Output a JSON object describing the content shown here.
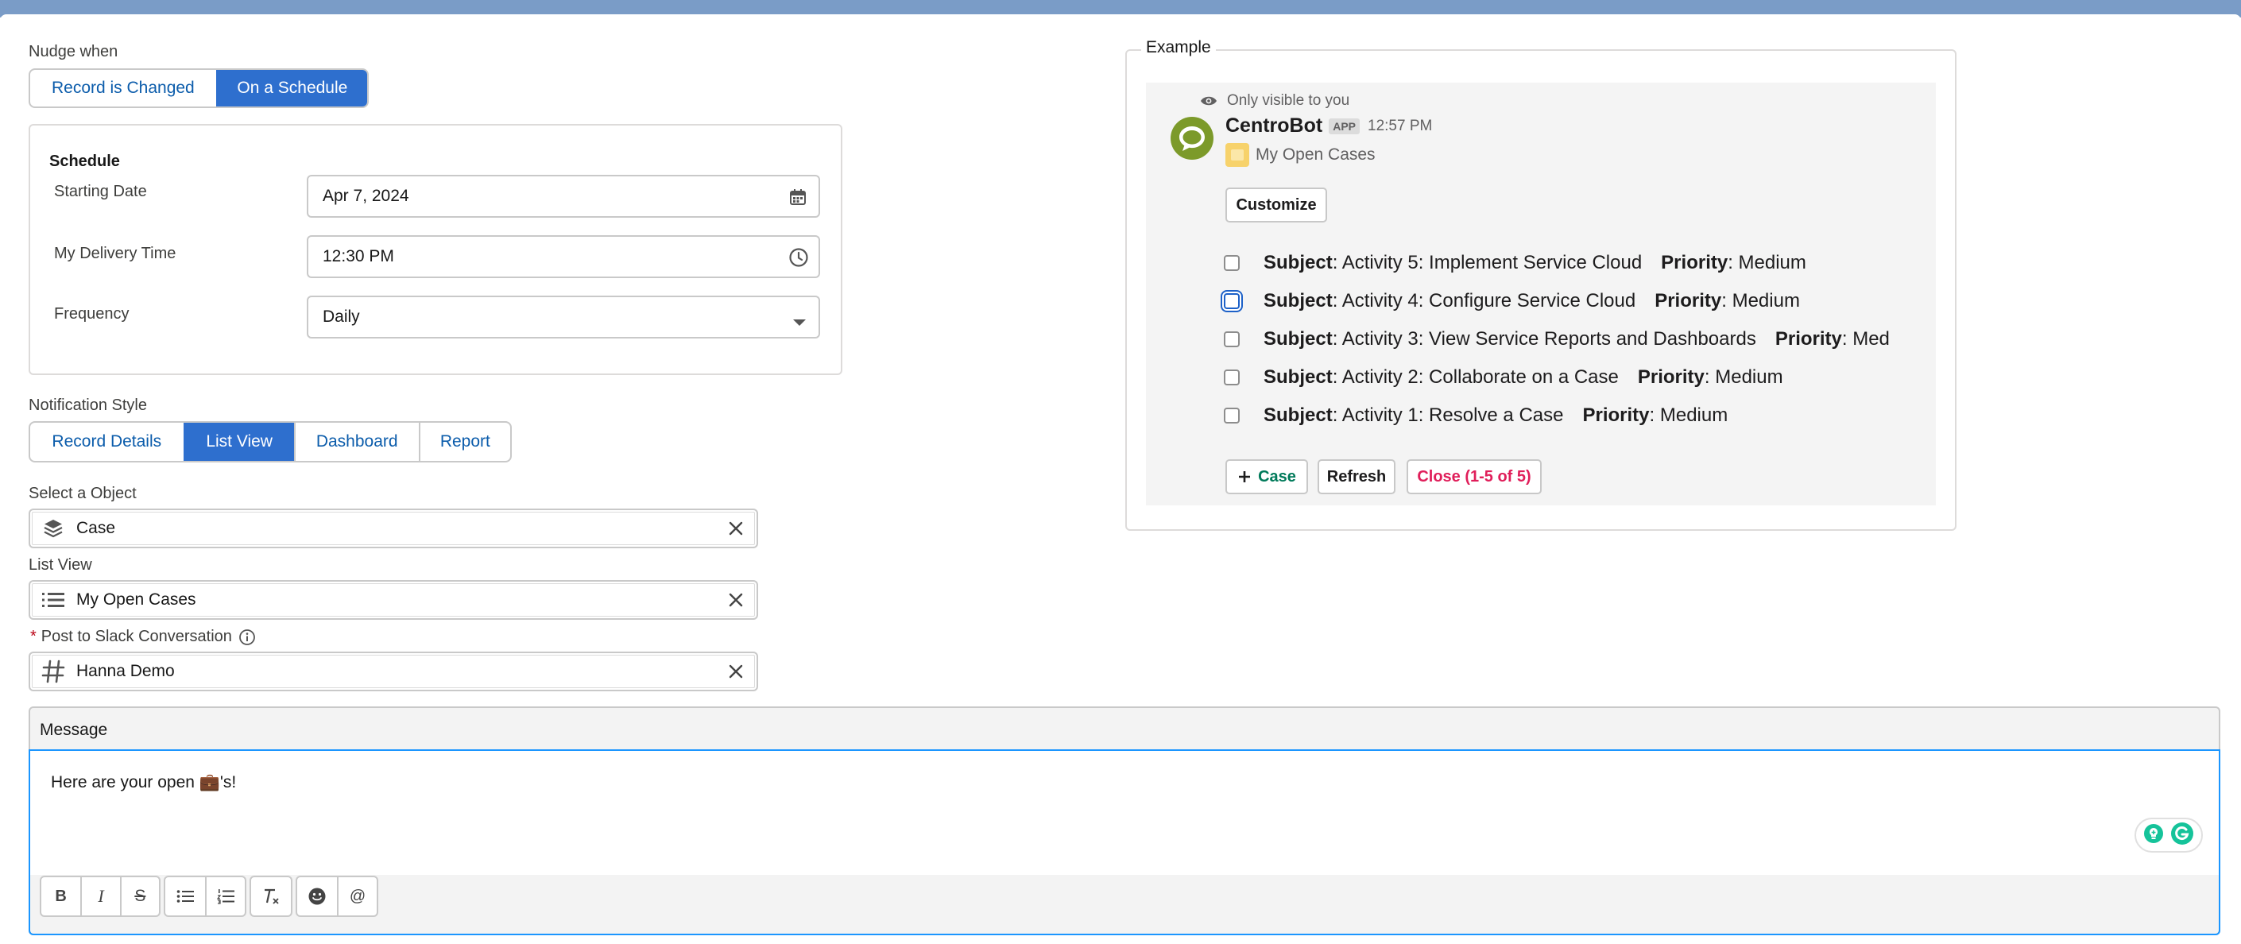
{
  "nudge": {
    "label": "Nudge when",
    "options": [
      "Record is Changed",
      "On a Schedule"
    ],
    "selected": "On a Schedule"
  },
  "schedule": {
    "title": "Schedule",
    "starting_date_label": "Starting Date",
    "starting_date_value": "Apr 7, 2024",
    "delivery_time_label": "My Delivery Time",
    "delivery_time_value": "12:30 PM",
    "frequency_label": "Frequency",
    "frequency_value": "Daily"
  },
  "notification": {
    "label": "Notification Style",
    "options": [
      "Record Details",
      "List View",
      "Dashboard",
      "Report"
    ],
    "selected": "List View"
  },
  "object_field": {
    "label": "Select a Object",
    "value": "Case",
    "icon": "stack-icon"
  },
  "list_view_field": {
    "label": "List View",
    "value": "My Open Cases",
    "icon": "list-icon"
  },
  "slack_field": {
    "required_mark": "*",
    "label": "Post to Slack Conversation",
    "value": "Hanna Demo",
    "icon": "hash-icon"
  },
  "message": {
    "header": "Message",
    "text": "Here are your open 💼's!",
    "toolbar": [
      "bold",
      "italic",
      "strikethrough",
      "bullet-list",
      "numbered-list",
      "clear-format",
      "emoji",
      "mention"
    ]
  },
  "example": {
    "legend": "Example",
    "visibility": "Only visible to you",
    "bot_name": "CentroBot",
    "app_badge": "APP",
    "time": "12:57 PM",
    "list_title": "My Open Cases",
    "customize_label": "Customize",
    "rows": [
      {
        "subject_label": "Subject",
        "subject": ": Activity 5: Implement Service Cloud",
        "priority_label": "Priority",
        "priority": ": Medium"
      },
      {
        "subject_label": "Subject",
        "subject": ": Activity 4: Configure Service Cloud",
        "priority_label": "Priority",
        "priority": ": Medium"
      },
      {
        "subject_label": "Subject",
        "subject": ": Activity 3: View Service Reports and Dashboards",
        "priority_label": "Priority",
        "priority": ": Med"
      },
      {
        "subject_label": "Subject",
        "subject": ": Activity 2: Collaborate on a Case",
        "priority_label": "Priority",
        "priority": ": Medium"
      },
      {
        "subject_label": "Subject",
        "subject": ": Activity 1: Resolve a Case",
        "priority_label": "Priority",
        "priority": ": Medium"
      }
    ],
    "add_case_label": "Case",
    "refresh_label": "Refresh",
    "close_label": "Close (1-5 of 5)"
  },
  "colors": {
    "brand": "#2e6fce",
    "link": "#0b5cab",
    "close": "#e01e5a",
    "add": "#007a5a",
    "bot": "#7c9a2a"
  }
}
